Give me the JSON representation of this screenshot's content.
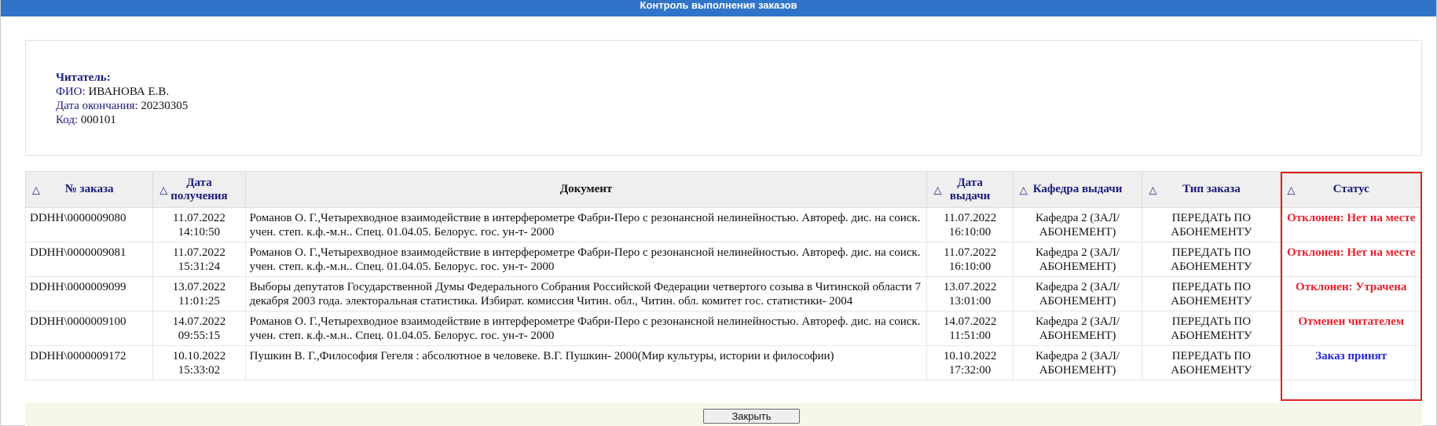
{
  "window": {
    "title": "Контроль выполнения заказов"
  },
  "reader": {
    "heading": "Читатель:",
    "fio_label": "ФИО:",
    "fio_value": "ИВАНОВА Е.В.",
    "end_date_label": "Дата окончания:",
    "end_date_value": "20230305",
    "code_label": "Код:",
    "code_value": "000101"
  },
  "table": {
    "sort_icon": "△",
    "columns": {
      "order_no": "№ заказа",
      "received_l1": "Дата",
      "received_l2": "получения",
      "document": "Документ",
      "issued_l1": "Дата",
      "issued_l2": "выдачи",
      "department": "Кафедра выдачи",
      "order_type": "Тип заказа",
      "status": "Статус"
    },
    "rows": [
      {
        "order_no": "DDHH\\0000009080",
        "received_date": "11.07.2022",
        "received_time": "14:10:50",
        "document": "Романов О. Г.,Четырехводное взаимодействие в интерферометре Фабри-Перо с резонансной нелинейностью. Автореф. дис. на соиск. учен. степ. к.ф.-м.н.. Спец. 01.04.05. Белорус. гос. ун-т- 2000",
        "issued_date": "11.07.2022",
        "issued_time": "16:10:00",
        "department_l1": "Кафедра 2 (ЗАЛ/",
        "department_l2": "АБОНЕМЕНТ)",
        "type_l1": "ПЕРЕДАТЬ ПО",
        "type_l2": "АБОНЕМЕНТУ",
        "status": "Отклонен: Нет на месте"
      },
      {
        "order_no": "DDHH\\0000009081",
        "received_date": "11.07.2022",
        "received_time": "15:31:24",
        "document": "Романов О. Г.,Четырехводное взаимодействие в интерферометре Фабри-Перо с резонансной нелинейностью. Автореф. дис. на соиск. учен. степ. к.ф.-м.н.. Спец. 01.04.05. Белорус. гос. ун-т- 2000",
        "issued_date": "11.07.2022",
        "issued_time": "16:10:00",
        "department_l1": "Кафедра 2 (ЗАЛ/",
        "department_l2": "АБОНЕМЕНТ)",
        "type_l1": "ПЕРЕДАТЬ ПО",
        "type_l2": "АБОНЕМЕНТУ",
        "status": "Отклонен: Нет на месте"
      },
      {
        "order_no": "DDHH\\0000009099",
        "received_date": "13.07.2022",
        "received_time": "11:01:25",
        "document": "Выборы депутатов Государственной Думы Федерального Собрания Российской Федерации четвертого созыва в Читинской области 7 декабря 2003 года. электоральная статистика. Избират. комиссия Читин. обл., Читин. обл. комитет гос. статистики- 2004",
        "issued_date": "13.07.2022",
        "issued_time": "13:01:00",
        "department_l1": "Кафедра 2 (ЗАЛ/",
        "department_l2": "АБОНЕМЕНТ)",
        "type_l1": "ПЕРЕДАТЬ ПО",
        "type_l2": "АБОНЕМЕНТУ",
        "status": "Отклонен: Утрачена"
      },
      {
        "order_no": "DDHH\\0000009100",
        "received_date": "14.07.2022",
        "received_time": "09:55:15",
        "document": "Романов О. Г.,Четырехводное взаимодействие в интерферометре Фабри-Перо с резонансной нелинейностью. Автореф. дис. на соиск. учен. степ. к.ф.-м.н.. Спец. 01.04.05. Белорус. гос. ун-т- 2000",
        "issued_date": "14.07.2022",
        "issued_time": "11:51:00",
        "department_l1": "Кафедра 2 (ЗАЛ/",
        "department_l2": "АБОНЕМЕНТ)",
        "type_l1": "ПЕРЕДАТЬ ПО",
        "type_l2": "АБОНЕМЕНТУ",
        "status": "Отменен читателем"
      },
      {
        "order_no": "DDHH\\0000009172",
        "received_date": "10.10.2022",
        "received_time": "15:33:02",
        "document": "Пушкин В. Г.,Философия Гегеля : абсолютное в человеке. В.Г. Пушкин- 2000(Мир культуры, истории и философии)",
        "issued_date": "10.10.2022",
        "issued_time": "17:32:00",
        "department_l1": "Кафедра 2 (ЗАЛ/",
        "department_l2": "АБОНЕМЕНТ)",
        "type_l1": "ПЕРЕДАТЬ ПО",
        "type_l2": "АБОНЕМЕНТУ",
        "status": "Заказ принят"
      }
    ]
  },
  "footer": {
    "close_label": "Закрыть"
  },
  "colors": {
    "titlebar": "#2f74c9",
    "status_rejected": "#e8202a",
    "status_accepted": "#2323d8",
    "highlight_frame": "#e02020"
  }
}
